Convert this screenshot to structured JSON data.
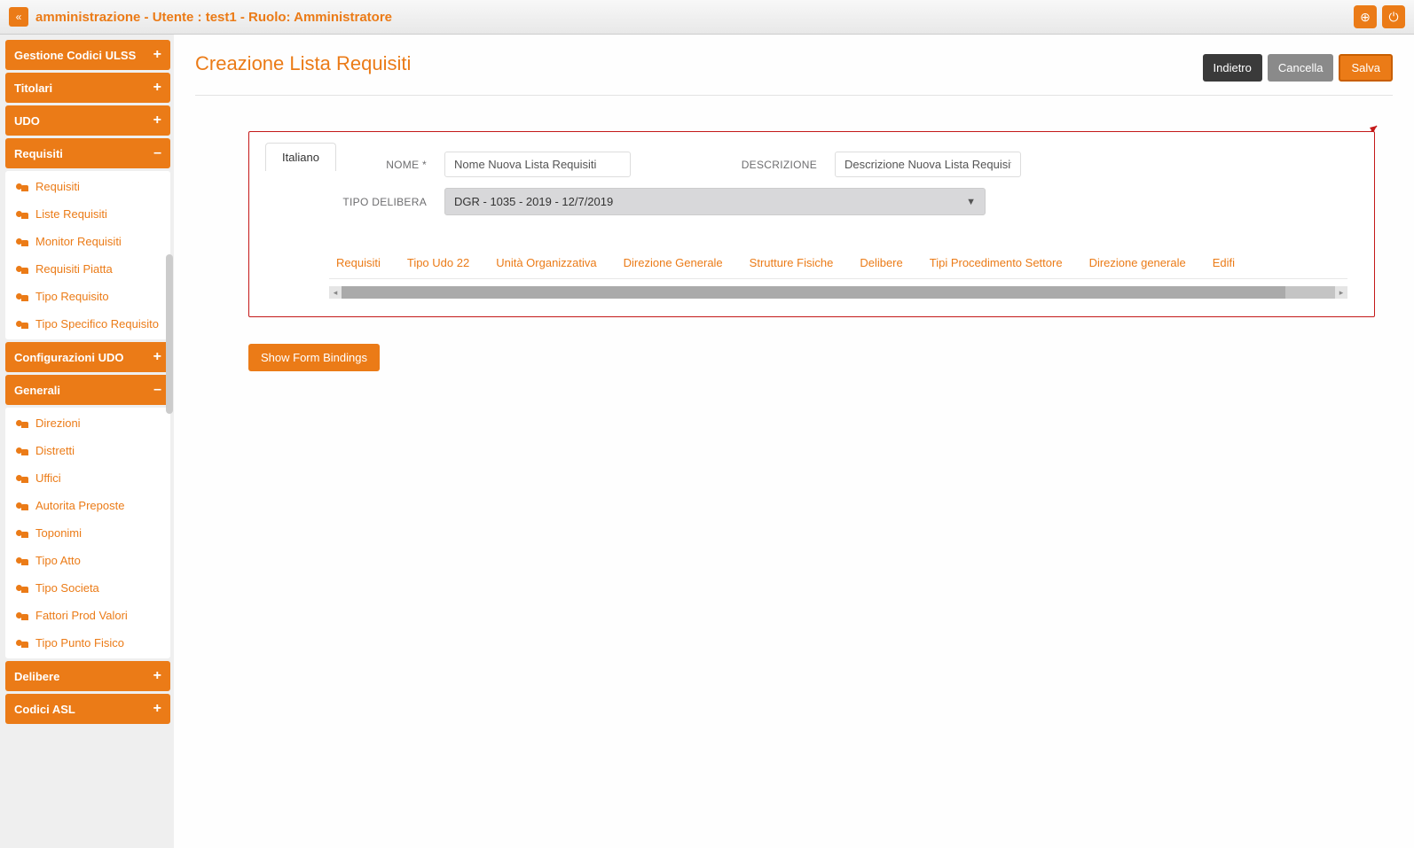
{
  "header": {
    "title": "amministrazione - Utente : test1 - Ruolo: Amministratore",
    "collapse_icon": "«",
    "globe_icon": "⊕",
    "power_icon": "⏻"
  },
  "sidebar": {
    "sections": [
      {
        "label": "Gestione Codici ULSS",
        "expanded": false,
        "toggle": "+"
      },
      {
        "label": "Titolari",
        "expanded": false,
        "toggle": "+"
      },
      {
        "label": "UDO",
        "expanded": false,
        "toggle": "+"
      },
      {
        "label": "Requisiti",
        "expanded": true,
        "toggle": "–",
        "items": [
          {
            "label": "Requisiti"
          },
          {
            "label": "Liste Requisiti"
          },
          {
            "label": "Monitor Requisiti"
          },
          {
            "label": "Requisiti Piatta"
          },
          {
            "label": "Tipo Requisito"
          },
          {
            "label": "Tipo Specifico Requisito"
          }
        ]
      },
      {
        "label": "Configurazioni UDO",
        "expanded": false,
        "toggle": "+"
      },
      {
        "label": "Generali",
        "expanded": true,
        "toggle": "–",
        "items": [
          {
            "label": "Direzioni"
          },
          {
            "label": "Distretti"
          },
          {
            "label": "Uffici"
          },
          {
            "label": "Autorita Preposte"
          },
          {
            "label": "Toponimi"
          },
          {
            "label": "Tipo Atto"
          },
          {
            "label": "Tipo Societa"
          },
          {
            "label": "Fattori Prod Valori"
          },
          {
            "label": "Tipo Punto Fisico"
          }
        ]
      },
      {
        "label": "Delibere",
        "expanded": false,
        "toggle": "+"
      },
      {
        "label": "Codici ASL",
        "expanded": false,
        "toggle": "+"
      }
    ]
  },
  "page": {
    "title": "Creazione Lista Requisiti",
    "buttons": {
      "back": "Indietro",
      "cancel": "Cancella",
      "save": "Salva"
    }
  },
  "form": {
    "lang_tab": "Italiano",
    "labels": {
      "nome": "NOME *",
      "descrizione": "DESCRIZIONE",
      "tipo_delibera": "TIPO DELIBERA"
    },
    "values": {
      "nome": "Nome Nuova Lista Requisiti",
      "descrizione": "Descrizione Nuova Lista Requisiti",
      "tipo_delibera": "DGR - 1035 - 2019 - 12/7/2019"
    },
    "sub_tabs": [
      "Requisiti",
      "Tipo Udo 22",
      "Unità Organizzativa",
      "Direzione Generale",
      "Strutture Fisiche",
      "Delibere",
      "Tipi Procedimento Settore",
      "Direzione generale",
      "Edifi"
    ]
  },
  "show_bindings_label": "Show Form Bindings"
}
